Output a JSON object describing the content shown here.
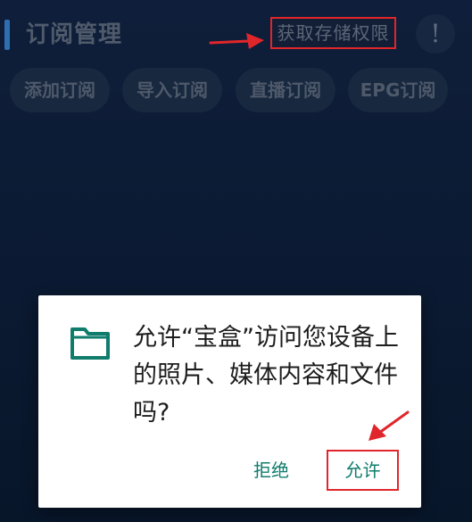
{
  "header": {
    "title": "订阅管理",
    "storage_permission_label": "获取存储权限",
    "info_label": "!"
  },
  "tabs": [
    {
      "label": "添加订阅"
    },
    {
      "label": "导入订阅"
    },
    {
      "label": "直播订阅"
    },
    {
      "label": "EPG订阅"
    }
  ],
  "dialog": {
    "message": "允许“宝盒”访问您设备上的照片、媒体内容和文件吗?",
    "deny_label": "拒绝",
    "allow_label": "允许"
  },
  "colors": {
    "background": "#0b1a32",
    "accent_bar": "#2e6fb2",
    "highlight_red": "#e0262b",
    "dialog_button_teal": "#0f7c6c",
    "folder_icon": "#0f7c6c"
  },
  "icons": {
    "folder": "folder-icon",
    "arrow": "red-arrow-annotation"
  }
}
